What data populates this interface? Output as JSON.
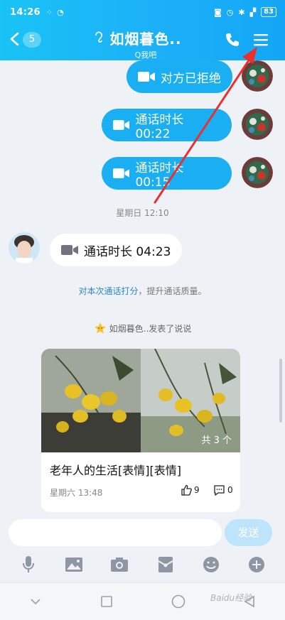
{
  "status_bar": {
    "time": "14:26",
    "battery": "83"
  },
  "header": {
    "back_count": "5",
    "title": "如烟暮色..",
    "subtitle": "Q我吧",
    "accent_color": "#1db0f8"
  },
  "messages": {
    "out": [
      {
        "text": "对方已拒绝"
      },
      {
        "text": "通话时长 00:22"
      },
      {
        "text": "通话时长 00:15"
      }
    ],
    "timestamp": "星期日 12:10",
    "in": {
      "text": "通话时长 04:23"
    },
    "rate_link": "对本次通话打分",
    "rate_rest": "，提升通话质量。",
    "post_notice": "如烟暮色..发表了说说"
  },
  "post_card": {
    "photo_count": "共 3 个",
    "text": "老年人的生活[表情][表情]",
    "time": "星期六 13:48",
    "likes": "9",
    "comments": "0"
  },
  "input": {
    "placeholder": "",
    "send_label": "发送"
  },
  "watermark": "Baidu经验"
}
